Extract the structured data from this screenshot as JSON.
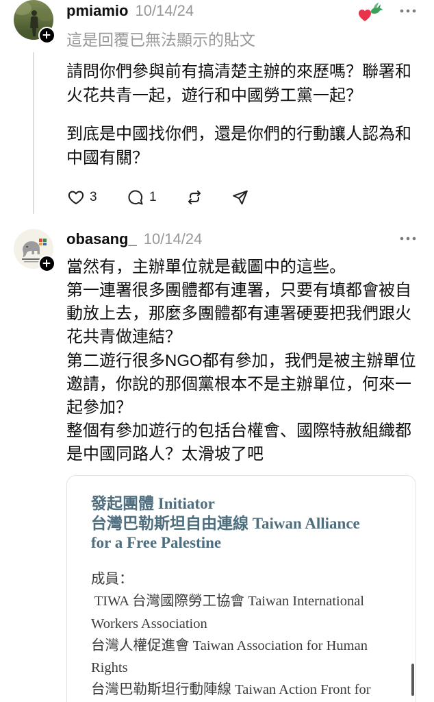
{
  "posts": [
    {
      "username": "pmiamio",
      "timestamp": "10/14/24",
      "badge_icon": "heart-dove-icon",
      "menu_icon": "more-icon",
      "reply_notice": "這是回覆已無法顯示的貼文",
      "body": [
        [
          "請問你們參與前有搞清楚主辦的來歷嗎？聯署和",
          "火花共青一起，遊行和中國勞工黨一起？"
        ],
        [
          "到底是中國找你們，還是你們的行動讓人認為和",
          "中國有關？"
        ]
      ],
      "like_count": "3",
      "reply_count": "1",
      "action_icons": [
        "heart-icon",
        "comment-icon",
        "repost-icon",
        "share-icon"
      ]
    },
    {
      "username": "obasang_",
      "timestamp": "10/14/24",
      "menu_icon": "more-icon",
      "body": [
        "當然有，主辦單位就是截圖中的這些。",
        "第一連署很多團體都有連署，只要有填都會被自",
        "動放上去，那麼多團體都有連署硬要把我們跟火",
        "花共青做連結？",
        "第二遊行很多NGO都有參加，我們是被主辦單位",
        "邀請，你說的那個黨根本不是主辦單位，何來一",
        "起參加？",
        "整個有參加遊行的包括台權會、國際特赦組織都",
        "是中國同路人？太滑坡了吧"
      ],
      "attachment": {
        "title": [
          "發起團體 Initiator",
          "台灣巴勒斯坦自由連線 Taiwan Alliance",
          "for a Free Palestine"
        ],
        "members": [
          "成員：",
          " TIWA 台灣國際勞工協會 Taiwan International",
          "Workers Association",
          "台灣人權促進會 Taiwan Association for Human",
          "Rights",
          "台灣巴勒斯坦行動陣線 Taiwan Action Front for"
        ]
      }
    }
  ],
  "colors": {
    "text": "#101010",
    "muted": "#999999",
    "thread_line": "#dcdcdc",
    "badge_heart": "#e8334a",
    "badge_dove": "#3aa15d",
    "attachment_title": "#4e6e7e",
    "attachment_text": "#3b3b3b",
    "attachment_border": "#e2e2e2"
  }
}
